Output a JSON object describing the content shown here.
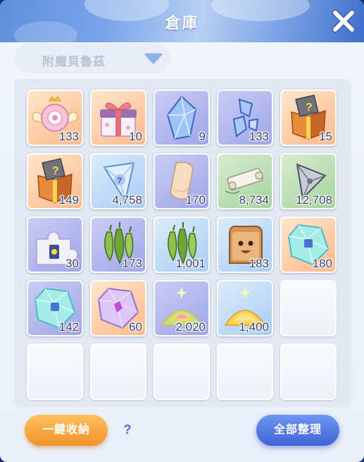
{
  "window": {
    "title": "倉庫"
  },
  "filter": {
    "selected": "附魔貝魯茲"
  },
  "footer": {
    "store_all": "一鍵收納",
    "help": "?",
    "sort_all": "全部整理"
  },
  "inventory": [
    {
      "icon": "winged-pink-emblem-icon",
      "count": "133",
      "bg": "orange"
    },
    {
      "icon": "ribbon-gift-box-icon",
      "count": "10",
      "bg": "orange"
    },
    {
      "icon": "blue-crystal-icon",
      "count": "9",
      "bg": "purple"
    },
    {
      "icon": "broken-crystal-icon",
      "count": "133",
      "bg": "purple"
    },
    {
      "icon": "mystery-gift-box-icon",
      "count": "15",
      "bg": "orange"
    },
    {
      "icon": "mystery-gift-box-icon",
      "count": "149",
      "bg": "orange"
    },
    {
      "icon": "crystal-shard-icon",
      "count": "4,758",
      "bg": "blue"
    },
    {
      "icon": "parchment-icon",
      "count": "170",
      "bg": "purple"
    },
    {
      "icon": "scroll-icon",
      "count": "8,734",
      "bg": "green"
    },
    {
      "icon": "shuriken-fragment-icon",
      "count": "12,708",
      "bg": "green"
    },
    {
      "icon": "puzzle-piece-icon",
      "count": "30",
      "bg": "purple"
    },
    {
      "icon": "green-pods-icon",
      "count": "173",
      "bg": "purple"
    },
    {
      "icon": "green-pods-icon",
      "count": "1,001",
      "bg": "blue"
    },
    {
      "icon": "toast-face-icon",
      "count": "183",
      "bg": "blue"
    },
    {
      "icon": "aqua-gem-icon",
      "count": "180",
      "bg": "orange"
    },
    {
      "icon": "aqua-gem-icon",
      "count": "142",
      "bg": "purple"
    },
    {
      "icon": "rainbow-gem-icon",
      "count": "60",
      "bg": "orange"
    },
    {
      "icon": "rainbow-sand-icon",
      "count": "2,020",
      "bg": "purple"
    },
    {
      "icon": "gold-sand-icon",
      "count": "1,400",
      "bg": "blue"
    },
    {
      "icon": "",
      "count": "",
      "bg": "empty"
    },
    {
      "icon": "",
      "count": "",
      "bg": "empty"
    },
    {
      "icon": "",
      "count": "",
      "bg": "empty"
    },
    {
      "icon": "",
      "count": "",
      "bg": "empty"
    },
    {
      "icon": "",
      "count": "",
      "bg": "empty"
    },
    {
      "icon": "",
      "count": "",
      "bg": "empty"
    }
  ]
}
